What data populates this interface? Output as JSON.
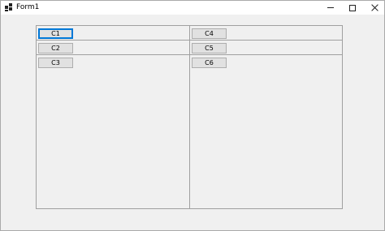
{
  "window": {
    "title": "Form1",
    "icon": "form-app-icon",
    "controls": {
      "minimize": "minimize-icon",
      "maximize": "maximize-icon",
      "close": "close-icon"
    }
  },
  "panel": {
    "buttons": [
      {
        "label": "C1",
        "focused": true
      },
      {
        "label": "C2"
      },
      {
        "label": "C3"
      },
      {
        "label": "C4"
      },
      {
        "label": "C5"
      },
      {
        "label": "C6"
      }
    ]
  },
  "colors": {
    "focus_border": "#0078d7",
    "button_face": "#e1e1e1",
    "form_background": "#f0f0f0"
  }
}
